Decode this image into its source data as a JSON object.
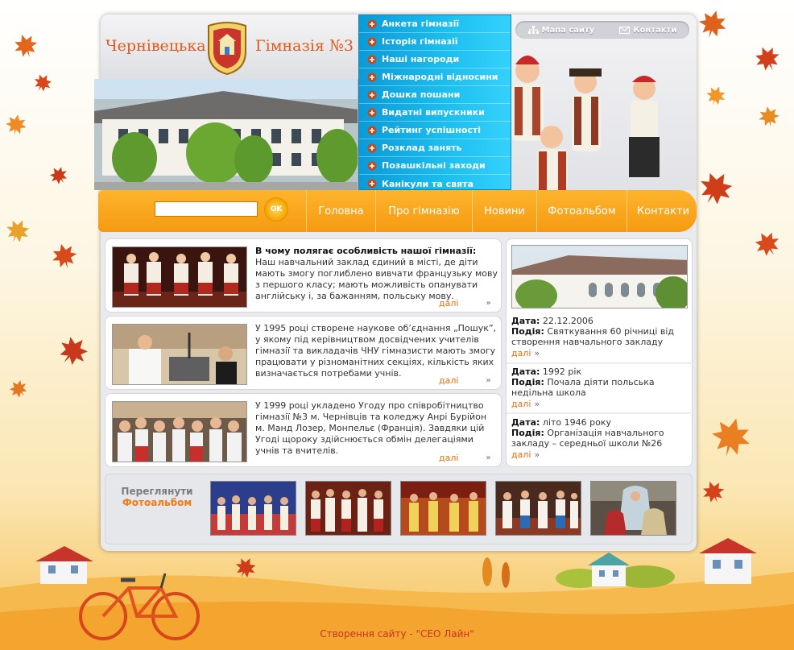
{
  "header": {
    "title_left": "Чернівецька",
    "title_right": "Гімназія №3"
  },
  "util_links": [
    {
      "label": "Мапа сайту",
      "icon": "sitemap-icon"
    },
    {
      "label": "Контакти",
      "icon": "envelope-icon"
    }
  ],
  "side_menu": [
    {
      "label": "Анкета гімназії"
    },
    {
      "label": "Історія гімназії"
    },
    {
      "label": "Наші нагороди"
    },
    {
      "label": "Міжнародні відносини"
    },
    {
      "label": "Дошка пошани"
    },
    {
      "label": "Видатні випускники"
    },
    {
      "label": "Рейтинг успішності"
    },
    {
      "label": "Розклад занять"
    },
    {
      "label": "Позашкільні заходи"
    },
    {
      "label": "Канікули та свята"
    }
  ],
  "search": {
    "value": "",
    "button_label": "OK"
  },
  "main_nav": [
    {
      "label": "Головна"
    },
    {
      "label": "Про гімназію"
    },
    {
      "label": "Новини"
    },
    {
      "label": "Фотоальбом"
    },
    {
      "label": "Контакти"
    }
  ],
  "news": [
    {
      "heading": "В чому полягає особливість нашої гімназії:",
      "body": "Наш навчальний заклад єдиний в місті, де діти мають змогу поглиблено вивчати французьку мову з першого класу; мають можливість опанувати англійську і, за бажанням, польську мову.",
      "more": "далі",
      "arrow": "»"
    },
    {
      "heading": "",
      "body": "У 1995 році створене наукове об’єднання „Пошук”, у якому під керівництвом досвідчених учителів гімназії та викладачів ЧНУ гімназисти мають змогу працювати у різноманітних секціях, кількість яких визначається потребами учнів.",
      "more": "далі",
      "arrow": "»"
    },
    {
      "heading": "",
      "body": "У 1999 році укладено Угоду про співробітництво гімназії №3 м. Чернівців та коледжу Анрі Бурійон м. Манд Лозер, Монпельє (Франція). Завдяки цій Угоді щороку здійснюється обмін делегаціями учнів та вчителів.",
      "more": "далі",
      "arrow": "»"
    }
  ],
  "events": [
    {
      "date_label": "Дата:",
      "date": "22.12.2006",
      "event_label": "Подія:",
      "event": "Святкування 60 річниці від створення навчального закладу",
      "more": "далі",
      "arrow": "»"
    },
    {
      "date_label": "Дата:",
      "date": "1992 рік",
      "event_label": "Подія:",
      "event": "Почала діяти польська недільна школа",
      "more": "далі",
      "arrow": "»"
    },
    {
      "date_label": "Дата:",
      "date": "літо 1946 року",
      "event_label": "Подія:",
      "event": "Організація навчального закладу – середньої школи №26",
      "more": "далі",
      "arrow": "»"
    }
  ],
  "gallery": {
    "label_line1": "Переглянути",
    "label_line2": "Фотоальбом"
  },
  "footer": {
    "credit": "Створення сайту - \"СЕО Лайн\""
  },
  "colors": {
    "accent_orange": "#f59a12",
    "menu_blue": "#1cc0f0",
    "title_orange": "#e05a1a",
    "link_orange": "#e07010",
    "credit_red": "#c8341b"
  }
}
